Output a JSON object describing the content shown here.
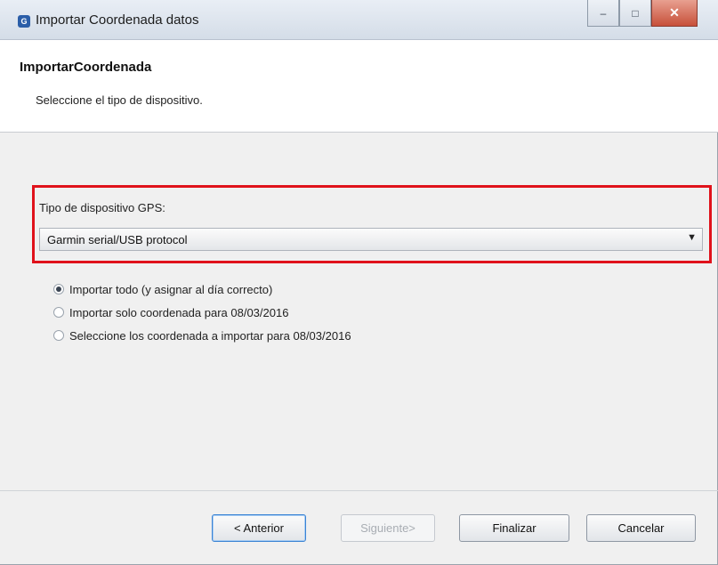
{
  "window": {
    "title": "Importar Coordenada datos",
    "controls": {
      "minimize": "–",
      "maximize": "□",
      "close": "✕"
    }
  },
  "header": {
    "title": "ImportarCoordenada",
    "description": "Seleccione el tipo de dispositivo."
  },
  "gps": {
    "label": "Tipo de dispositivo GPS:",
    "selected": "Garmin serial/USB protocol",
    "arrow": "▼",
    "highlight_color": "#e0121b"
  },
  "options": [
    {
      "label": "Importar todo (y asignar al día correcto)",
      "checked": true
    },
    {
      "label": "Importar solo coordenada para 08/03/2016",
      "checked": false
    },
    {
      "label": "Seleccione los coordenada a importar para 08/03/2016",
      "checked": false
    }
  ],
  "buttons": {
    "back": "< Anterior",
    "next": "Siguiente>",
    "finish": "Finalizar",
    "cancel": "Cancelar"
  }
}
